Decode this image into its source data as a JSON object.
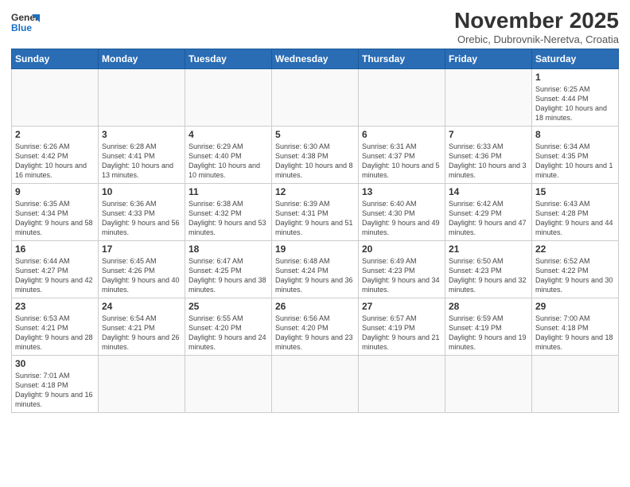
{
  "logo": {
    "text_general": "General",
    "text_blue": "Blue"
  },
  "title": "November 2025",
  "subtitle": "Orebic, Dubrovnik-Neretva, Croatia",
  "weekdays": [
    "Sunday",
    "Monday",
    "Tuesday",
    "Wednesday",
    "Thursday",
    "Friday",
    "Saturday"
  ],
  "weeks": [
    [
      {
        "day": "",
        "info": ""
      },
      {
        "day": "",
        "info": ""
      },
      {
        "day": "",
        "info": ""
      },
      {
        "day": "",
        "info": ""
      },
      {
        "day": "",
        "info": ""
      },
      {
        "day": "",
        "info": ""
      },
      {
        "day": "1",
        "info": "Sunrise: 6:25 AM\nSunset: 4:44 PM\nDaylight: 10 hours and 18 minutes."
      }
    ],
    [
      {
        "day": "2",
        "info": "Sunrise: 6:26 AM\nSunset: 4:42 PM\nDaylight: 10 hours and 16 minutes."
      },
      {
        "day": "3",
        "info": "Sunrise: 6:28 AM\nSunset: 4:41 PM\nDaylight: 10 hours and 13 minutes."
      },
      {
        "day": "4",
        "info": "Sunrise: 6:29 AM\nSunset: 4:40 PM\nDaylight: 10 hours and 10 minutes."
      },
      {
        "day": "5",
        "info": "Sunrise: 6:30 AM\nSunset: 4:38 PM\nDaylight: 10 hours and 8 minutes."
      },
      {
        "day": "6",
        "info": "Sunrise: 6:31 AM\nSunset: 4:37 PM\nDaylight: 10 hours and 5 minutes."
      },
      {
        "day": "7",
        "info": "Sunrise: 6:33 AM\nSunset: 4:36 PM\nDaylight: 10 hours and 3 minutes."
      },
      {
        "day": "8",
        "info": "Sunrise: 6:34 AM\nSunset: 4:35 PM\nDaylight: 10 hours and 1 minute."
      }
    ],
    [
      {
        "day": "9",
        "info": "Sunrise: 6:35 AM\nSunset: 4:34 PM\nDaylight: 9 hours and 58 minutes."
      },
      {
        "day": "10",
        "info": "Sunrise: 6:36 AM\nSunset: 4:33 PM\nDaylight: 9 hours and 56 minutes."
      },
      {
        "day": "11",
        "info": "Sunrise: 6:38 AM\nSunset: 4:32 PM\nDaylight: 9 hours and 53 minutes."
      },
      {
        "day": "12",
        "info": "Sunrise: 6:39 AM\nSunset: 4:31 PM\nDaylight: 9 hours and 51 minutes."
      },
      {
        "day": "13",
        "info": "Sunrise: 6:40 AM\nSunset: 4:30 PM\nDaylight: 9 hours and 49 minutes."
      },
      {
        "day": "14",
        "info": "Sunrise: 6:42 AM\nSunset: 4:29 PM\nDaylight: 9 hours and 47 minutes."
      },
      {
        "day": "15",
        "info": "Sunrise: 6:43 AM\nSunset: 4:28 PM\nDaylight: 9 hours and 44 minutes."
      }
    ],
    [
      {
        "day": "16",
        "info": "Sunrise: 6:44 AM\nSunset: 4:27 PM\nDaylight: 9 hours and 42 minutes."
      },
      {
        "day": "17",
        "info": "Sunrise: 6:45 AM\nSunset: 4:26 PM\nDaylight: 9 hours and 40 minutes."
      },
      {
        "day": "18",
        "info": "Sunrise: 6:47 AM\nSunset: 4:25 PM\nDaylight: 9 hours and 38 minutes."
      },
      {
        "day": "19",
        "info": "Sunrise: 6:48 AM\nSunset: 4:24 PM\nDaylight: 9 hours and 36 minutes."
      },
      {
        "day": "20",
        "info": "Sunrise: 6:49 AM\nSunset: 4:23 PM\nDaylight: 9 hours and 34 minutes."
      },
      {
        "day": "21",
        "info": "Sunrise: 6:50 AM\nSunset: 4:23 PM\nDaylight: 9 hours and 32 minutes."
      },
      {
        "day": "22",
        "info": "Sunrise: 6:52 AM\nSunset: 4:22 PM\nDaylight: 9 hours and 30 minutes."
      }
    ],
    [
      {
        "day": "23",
        "info": "Sunrise: 6:53 AM\nSunset: 4:21 PM\nDaylight: 9 hours and 28 minutes."
      },
      {
        "day": "24",
        "info": "Sunrise: 6:54 AM\nSunset: 4:21 PM\nDaylight: 9 hours and 26 minutes."
      },
      {
        "day": "25",
        "info": "Sunrise: 6:55 AM\nSunset: 4:20 PM\nDaylight: 9 hours and 24 minutes."
      },
      {
        "day": "26",
        "info": "Sunrise: 6:56 AM\nSunset: 4:20 PM\nDaylight: 9 hours and 23 minutes."
      },
      {
        "day": "27",
        "info": "Sunrise: 6:57 AM\nSunset: 4:19 PM\nDaylight: 9 hours and 21 minutes."
      },
      {
        "day": "28",
        "info": "Sunrise: 6:59 AM\nSunset: 4:19 PM\nDaylight: 9 hours and 19 minutes."
      },
      {
        "day": "29",
        "info": "Sunrise: 7:00 AM\nSunset: 4:18 PM\nDaylight: 9 hours and 18 minutes."
      }
    ],
    [
      {
        "day": "30",
        "info": "Sunrise: 7:01 AM\nSunset: 4:18 PM\nDaylight: 9 hours and 16 minutes."
      },
      {
        "day": "",
        "info": ""
      },
      {
        "day": "",
        "info": ""
      },
      {
        "day": "",
        "info": ""
      },
      {
        "day": "",
        "info": ""
      },
      {
        "day": "",
        "info": ""
      },
      {
        "day": "",
        "info": ""
      }
    ]
  ]
}
